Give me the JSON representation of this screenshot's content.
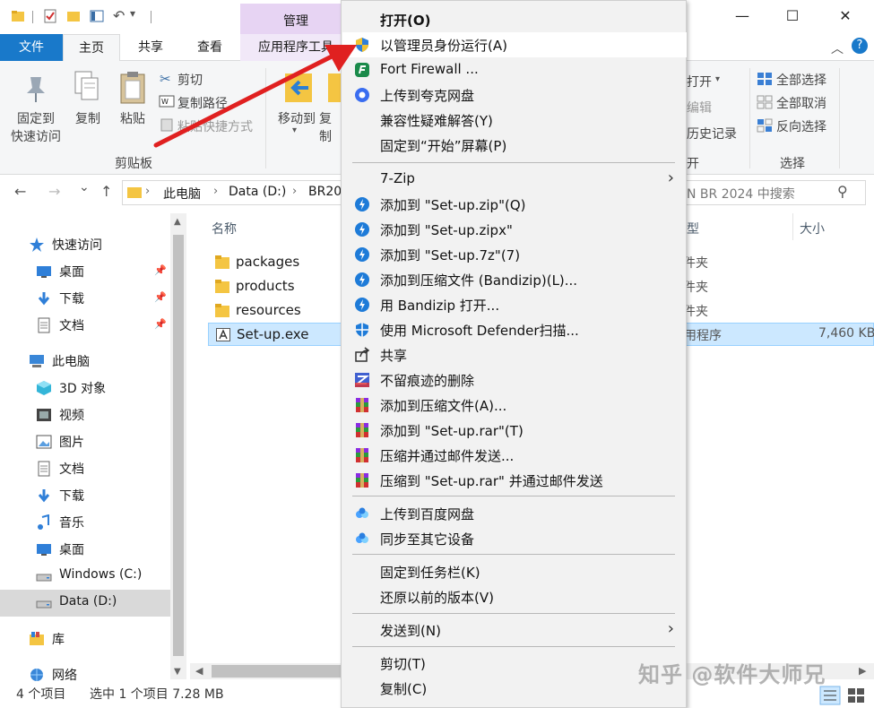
{
  "titlebar": {
    "manage_tab": "管理",
    "minimize": "—",
    "maximize": "☐",
    "close": "✕"
  },
  "ribbon_tabs": {
    "file": "文件",
    "home": "主页",
    "share": "共享",
    "view": "查看",
    "app_tools": "应用程序工具",
    "collapse": "︿",
    "help": "?"
  },
  "ribbon": {
    "pin_quick": "固定到",
    "pin_quick2": "快速访问",
    "copy": "复制",
    "paste": "粘贴",
    "cut": "剪切",
    "copy_path": "复制路径",
    "paste_shortcut": "粘贴快捷方式",
    "clipboard_group": "剪贴板",
    "move_to": "移动到",
    "copy_to": "复制",
    "open": "打开",
    "open_caret": "▾",
    "edit": "编辑",
    "history": "历史记录",
    "open_group": "开",
    "select_all": "全部选择",
    "select_none": "全部取消",
    "invert_select": "反向选择",
    "select_group": "选择"
  },
  "address": {
    "back": "←",
    "forward": "→",
    "recent": "⌄",
    "up": "↑",
    "crumbs": [
      "此电脑",
      "Data (D:)",
      "BR20"
    ],
    "crumb_sep": "›",
    "search_placeholder": "N BR 2024 中搜索",
    "search_icon": "⚲"
  },
  "nav": {
    "items": [
      {
        "label": "快速访问",
        "icon": "star-icon",
        "pin": ""
      },
      {
        "label": "桌面",
        "icon": "desktop-icon",
        "pin": "📌"
      },
      {
        "label": "下载",
        "icon": "download-icon",
        "pin": "📌"
      },
      {
        "label": "文档",
        "icon": "document-icon",
        "pin": "📌"
      },
      {
        "label": "此电脑",
        "icon": "computer-icon",
        "pin": ""
      },
      {
        "label": "3D 对象",
        "icon": "cube-icon",
        "pin": ""
      },
      {
        "label": "视频",
        "icon": "video-icon",
        "pin": ""
      },
      {
        "label": "图片",
        "icon": "picture-icon",
        "pin": ""
      },
      {
        "label": "文档",
        "icon": "document-icon",
        "pin": ""
      },
      {
        "label": "下载",
        "icon": "download-icon",
        "pin": ""
      },
      {
        "label": "音乐",
        "icon": "music-icon",
        "pin": ""
      },
      {
        "label": "桌面",
        "icon": "desktop-icon",
        "pin": ""
      },
      {
        "label": "Windows (C:)",
        "icon": "drive-icon",
        "pin": ""
      },
      {
        "label": "Data (D:)",
        "icon": "drive-icon",
        "pin": ""
      },
      {
        "label": "库",
        "icon": "library-icon",
        "pin": ""
      },
      {
        "label": "网络",
        "icon": "network-icon",
        "pin": ""
      }
    ]
  },
  "filelist": {
    "col_name": "名称",
    "col_type": "型",
    "col_size": "大小",
    "rows": [
      {
        "name": "packages",
        "type": "件夹",
        "size": ""
      },
      {
        "name": "products",
        "type": "件夹",
        "size": ""
      },
      {
        "name": "resources",
        "type": "件夹",
        "size": ""
      },
      {
        "name": "Set-up.exe",
        "type": "用程序",
        "size": "7,460 KB"
      }
    ]
  },
  "status": {
    "count": "4 个项目",
    "selected": "选中 1 个项目  7.28 MB"
  },
  "menu": {
    "items": [
      {
        "label": "打开(O)",
        "icon": "",
        "bold": true
      },
      {
        "label": "以管理员身份运行(A)",
        "icon": "uac-shield-icon"
      },
      {
        "label": "Fort Firewall ...",
        "icon": "fort-firewall-icon"
      },
      {
        "label": "上传到夸克网盘",
        "icon": "quark-icon"
      },
      {
        "label": "兼容性疑难解答(Y)",
        "icon": ""
      },
      {
        "label": "固定到“开始”屏幕(P)",
        "icon": ""
      },
      {
        "label": "7-Zip",
        "icon": "",
        "submenu": true
      },
      {
        "label": "添加到 \"Set-up.zip\"(Q)",
        "icon": "bandizip-icon"
      },
      {
        "label": "添加到 \"Set-up.zipx\"",
        "icon": "bandizip-icon"
      },
      {
        "label": "添加到 \"Set-up.7z\"(7)",
        "icon": "bandizip-icon"
      },
      {
        "label": "添加到压缩文件 (Bandizip)(L)...",
        "icon": "bandizip-icon"
      },
      {
        "label": "用 Bandizip 打开...",
        "icon": "bandizip-icon"
      },
      {
        "label": "使用 Microsoft Defender扫描...",
        "icon": "defender-icon"
      },
      {
        "label": "共享",
        "icon": "share-icon"
      },
      {
        "label": "不留痕迹的删除",
        "icon": "shred-icon"
      },
      {
        "label": "添加到压缩文件(A)...",
        "icon": "winrar-icon"
      },
      {
        "label": "添加到 \"Set-up.rar\"(T)",
        "icon": "winrar-icon"
      },
      {
        "label": "压缩并通过邮件发送...",
        "icon": "winrar-icon"
      },
      {
        "label": "压缩到 \"Set-up.rar\" 并通过邮件发送",
        "icon": "winrar-icon"
      },
      {
        "label": "上传到百度网盘",
        "icon": "baidu-cloud-icon"
      },
      {
        "label": "同步至其它设备",
        "icon": "baidu-cloud-icon"
      },
      {
        "label": "固定到任务栏(K)",
        "icon": ""
      },
      {
        "label": "还原以前的版本(V)",
        "icon": ""
      },
      {
        "label": "发送到(N)",
        "icon": "",
        "submenu": true
      },
      {
        "label": "剪切(T)",
        "icon": ""
      },
      {
        "label": "复制(C)",
        "icon": ""
      }
    ],
    "submenu_arrow": "›"
  },
  "watermark": "知乎 @软件大师兄",
  "colors": {
    "accent": "#1979ca",
    "selection": "#cce8ff",
    "arrow": "#e02020",
    "manage_tab": "#e7d4f3"
  }
}
